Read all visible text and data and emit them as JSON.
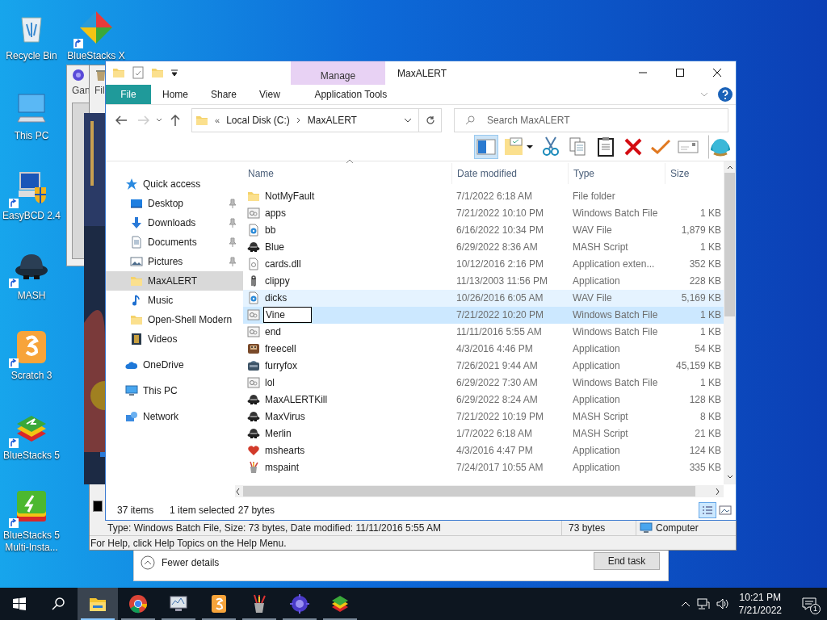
{
  "desktop_icons": [
    {
      "label": "Recycle Bin",
      "kind": "recycle",
      "shortcut": false
    },
    {
      "label": "This PC",
      "kind": "pc",
      "shortcut": false
    },
    {
      "label": "EasyBCD 2.4",
      "kind": "easybcd",
      "shortcut": true
    },
    {
      "label": "MASH",
      "kind": "mash",
      "shortcut": true
    },
    {
      "label": "Scratch 3",
      "kind": "scratch",
      "shortcut": true
    },
    {
      "label": "BlueStacks 5",
      "kind": "bluestacks",
      "shortcut": true
    },
    {
      "label": "BlueStacks 5 Multi-Insta...",
      "kind": "bluestacks-multi",
      "shortcut": true
    }
  ],
  "desktop_icons_column_2": [
    {
      "label": "BlueStacks X",
      "kind": "bluestacks-x",
      "shortcut": true
    }
  ],
  "back_windows": {
    "game_window_title": "Gan",
    "file_window_title": "Fil",
    "details_bar": {
      "text": "Type: Windows Batch File, Size: 73 bytes, Date modified: 11/11/2016 5:55 AM",
      "size": "73 bytes",
      "zone": "Computer"
    },
    "help_bar": "For Help, click Help Topics on the Help Menu.",
    "task_manager": {
      "toggle": "Fewer details",
      "button": "End task"
    }
  },
  "explorer": {
    "title": "MaxALERT",
    "context_tab": "Manage",
    "tabs": [
      {
        "label": "File",
        "kind": "file"
      },
      {
        "label": "Home",
        "kind": "tab"
      },
      {
        "label": "Share",
        "kind": "tab"
      },
      {
        "label": "View",
        "kind": "tab"
      },
      {
        "label": "Application Tools",
        "kind": "context"
      }
    ],
    "address": {
      "overflow": "«",
      "segments": [
        "Local Disk (C:)",
        "MaxALERT"
      ]
    },
    "search": {
      "placeholder": "Search MaxALERT"
    },
    "toolbar": [
      {
        "kind": "pane",
        "selected": true
      },
      {
        "kind": "new-folder",
        "selected": false
      },
      {
        "kind": "cut",
        "selected": false
      },
      {
        "kind": "copy",
        "selected": false
      },
      {
        "kind": "paste",
        "selected": false
      },
      {
        "kind": "delete",
        "selected": false
      },
      {
        "kind": "check",
        "selected": false
      },
      {
        "kind": "mail",
        "selected": false
      },
      {
        "kind": "shell",
        "selected": false
      }
    ],
    "nav": [
      {
        "label": "Quick access",
        "kind": "star",
        "selected": false,
        "children": [
          {
            "label": "Desktop",
            "kind": "desktop",
            "pinned": true,
            "selected": false
          },
          {
            "label": "Downloads",
            "kind": "downloads",
            "pinned": true,
            "selected": false
          },
          {
            "label": "Documents",
            "kind": "documents",
            "pinned": true,
            "selected": false
          },
          {
            "label": "Pictures",
            "kind": "pictures",
            "pinned": true,
            "selected": false
          },
          {
            "label": "MaxALERT",
            "kind": "folder",
            "pinned": false,
            "selected": true
          },
          {
            "label": "Music",
            "kind": "music",
            "pinned": false,
            "selected": false
          },
          {
            "label": "Open-Shell Modern",
            "kind": "folder",
            "pinned": false,
            "selected": false
          },
          {
            "label": "Videos",
            "kind": "videos",
            "pinned": false,
            "selected": false
          }
        ]
      },
      {
        "label": "OneDrive",
        "kind": "cloud",
        "selected": false
      },
      {
        "label": "This PC",
        "kind": "pc",
        "selected": false
      },
      {
        "label": "Network",
        "kind": "network",
        "selected": false
      }
    ],
    "columns": [
      "Name",
      "Date modified",
      "Type",
      "Size"
    ],
    "rows": [
      {
        "name": "NotMyFault",
        "date": "7/1/2022 6:18 AM",
        "type": "File folder",
        "size": "",
        "kind": "folder",
        "selected": false,
        "hovered": false,
        "editing": false
      },
      {
        "name": "apps",
        "date": "7/21/2022 10:10 PM",
        "type": "Windows Batch File",
        "size": "1 KB",
        "kind": "batch",
        "selected": false,
        "hovered": false,
        "editing": false
      },
      {
        "name": "bb",
        "date": "6/16/2022 10:34 PM",
        "type": "WAV File",
        "size": "1,879 KB",
        "kind": "wav",
        "selected": false,
        "hovered": false,
        "editing": false
      },
      {
        "name": "Blue",
        "date": "6/29/2022 8:36 AM",
        "type": "MASH Script",
        "size": "1 KB",
        "kind": "mash",
        "selected": false,
        "hovered": false,
        "editing": false
      },
      {
        "name": "cards.dll",
        "date": "10/12/2016 2:16 PM",
        "type": "Application exten...",
        "size": "352 KB",
        "kind": "dll",
        "selected": false,
        "hovered": false,
        "editing": false
      },
      {
        "name": "clippy",
        "date": "11/13/2003 11:56 PM",
        "type": "Application",
        "size": "228 KB",
        "kind": "clippy",
        "selected": false,
        "hovered": false,
        "editing": false
      },
      {
        "name": "dicks",
        "date": "10/26/2016 6:05 AM",
        "type": "WAV File",
        "size": "5,169 KB",
        "kind": "wav",
        "selected": false,
        "hovered": true,
        "editing": false
      },
      {
        "name": "Vine",
        "date": "7/21/2022 10:20 PM",
        "type": "Windows Batch File",
        "size": "1 KB",
        "kind": "batch",
        "selected": true,
        "hovered": false,
        "editing": true
      },
      {
        "name": "end",
        "date": "11/11/2016 5:55 AM",
        "type": "Windows Batch File",
        "size": "1 KB",
        "kind": "batch",
        "selected": false,
        "hovered": false,
        "editing": false
      },
      {
        "name": "freecell",
        "date": "4/3/2016 4:46 PM",
        "type": "Application",
        "size": "54 KB",
        "kind": "freecell",
        "selected": false,
        "hovered": false,
        "editing": false
      },
      {
        "name": "furryfox",
        "date": "7/26/2021 9:44 AM",
        "type": "Application",
        "size": "45,159 KB",
        "kind": "furryfox",
        "selected": false,
        "hovered": false,
        "editing": false
      },
      {
        "name": "lol",
        "date": "6/29/2022 7:30 AM",
        "type": "Windows Batch File",
        "size": "1 KB",
        "kind": "batch",
        "selected": false,
        "hovered": false,
        "editing": false
      },
      {
        "name": "MaxALERTKill",
        "date": "6/29/2022 8:24 AM",
        "type": "Application",
        "size": "128 KB",
        "kind": "mash",
        "selected": false,
        "hovered": false,
        "editing": false
      },
      {
        "name": "MaxVirus",
        "date": "7/21/2022 10:19 PM",
        "type": "MASH Script",
        "size": "8 KB",
        "kind": "mash",
        "selected": false,
        "hovered": false,
        "editing": false
      },
      {
        "name": "Merlin",
        "date": "1/7/2022 6:18 AM",
        "type": "MASH Script",
        "size": "21 KB",
        "kind": "mash",
        "selected": false,
        "hovered": false,
        "editing": false
      },
      {
        "name": "mshearts",
        "date": "4/3/2016 4:47 PM",
        "type": "Application",
        "size": "124 KB",
        "kind": "hearts",
        "selected": false,
        "hovered": false,
        "editing": false
      },
      {
        "name": "mspaint",
        "date": "7/24/2017 10:55 AM",
        "type": "Application",
        "size": "335 KB",
        "kind": "paint",
        "selected": false,
        "hovered": false,
        "editing": false
      }
    ],
    "status": {
      "count": "37 items",
      "selection": "1 item selected",
      "size": "27 bytes"
    }
  },
  "taskbar": {
    "apps": [
      {
        "kind": "explorer",
        "active": true
      },
      {
        "kind": "chrome",
        "active": false
      },
      {
        "kind": "monitor",
        "active": false
      },
      {
        "kind": "scratch",
        "active": false
      },
      {
        "kind": "paint",
        "active": false
      },
      {
        "kind": "globe",
        "active": false
      },
      {
        "kind": "bluestacks",
        "active": false
      }
    ],
    "time": "10:21 PM",
    "date": "7/21/2022",
    "notifications": "1"
  }
}
